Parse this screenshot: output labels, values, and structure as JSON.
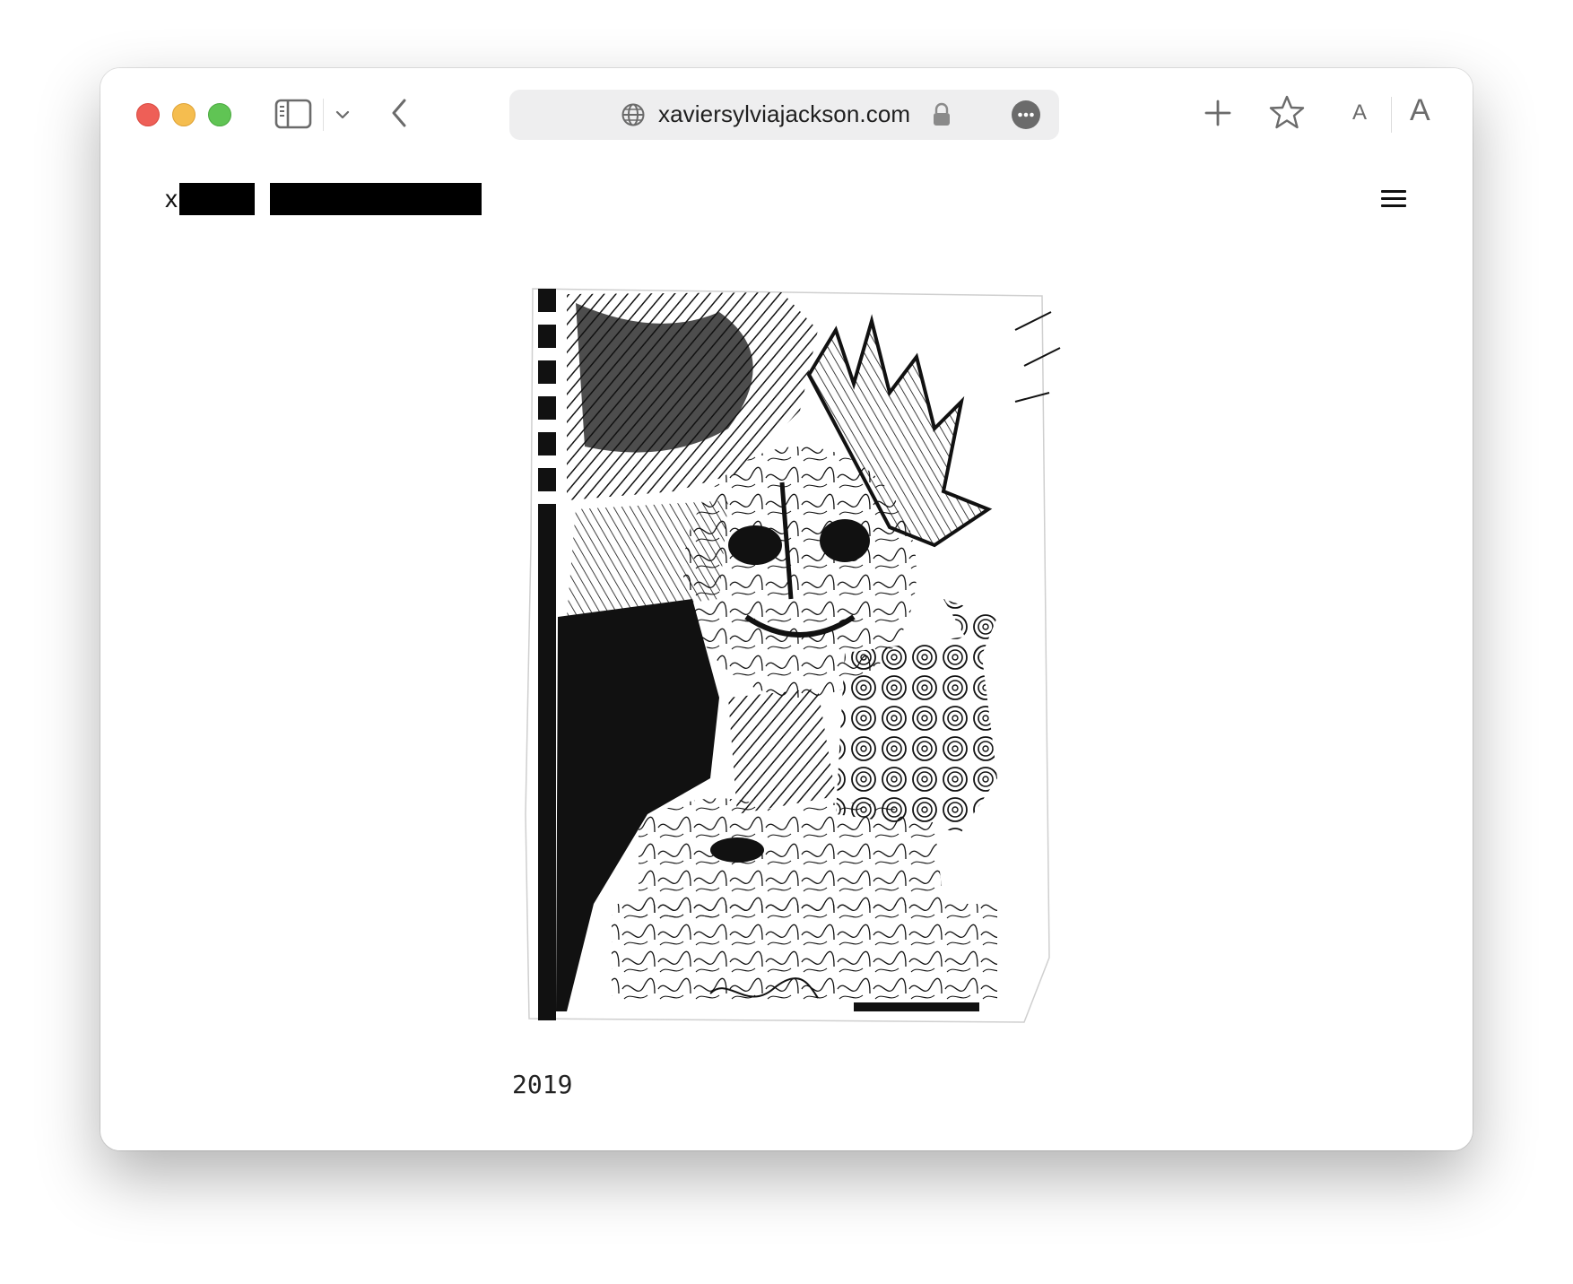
{
  "browser": {
    "url": "xaviersylviajackson.com",
    "traffic_lights": {
      "close": "#ee5f57",
      "minimize": "#f5bd4f",
      "maximize": "#60c454"
    },
    "font_small_label": "A",
    "font_large_label": "A",
    "icons": [
      "sidebar-icon",
      "chevron-down-icon",
      "back-icon",
      "globe-icon",
      "lock-icon",
      "more-icon",
      "plus-icon",
      "star-icon"
    ]
  },
  "site": {
    "logo_initial": "x",
    "year": "2019"
  }
}
